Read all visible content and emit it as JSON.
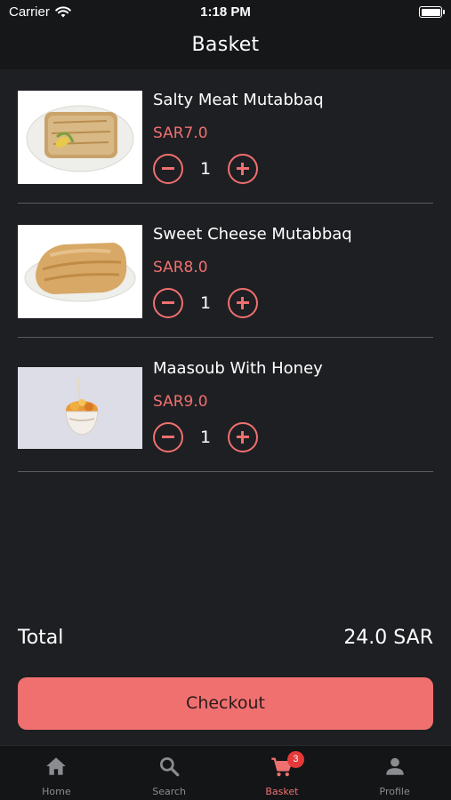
{
  "status_bar": {
    "carrier": "Carrier",
    "time": "1:18 PM"
  },
  "header": {
    "title": "Basket"
  },
  "basket": {
    "items": [
      {
        "name": "Salty Meat Mutabbaq",
        "price": "SAR7.0",
        "quantity": "1",
        "image_icon": "meat-mutabbaq-image"
      },
      {
        "name": "Sweet Cheese Mutabbaq",
        "price": "SAR8.0",
        "quantity": "1",
        "image_icon": "cheese-mutabbaq-image"
      },
      {
        "name": "Maasoub With Honey",
        "price": "SAR9.0",
        "quantity": "1",
        "image_icon": "maasoub-bowl-image"
      }
    ]
  },
  "summary": {
    "total_label": "Total",
    "total_value": "24.0 SAR"
  },
  "checkout": {
    "label": "Checkout"
  },
  "tabbar": {
    "tabs": [
      {
        "label": "Home",
        "icon": "home-icon"
      },
      {
        "label": "Search",
        "icon": "search-icon"
      },
      {
        "label": "Basket",
        "icon": "cart-icon",
        "badge": "3",
        "active": true
      },
      {
        "label": "Profile",
        "icon": "profile-icon"
      }
    ]
  },
  "colors": {
    "accent": "#f07070",
    "background": "#1e1f22",
    "bar": "#161719",
    "badge": "#e63939"
  }
}
